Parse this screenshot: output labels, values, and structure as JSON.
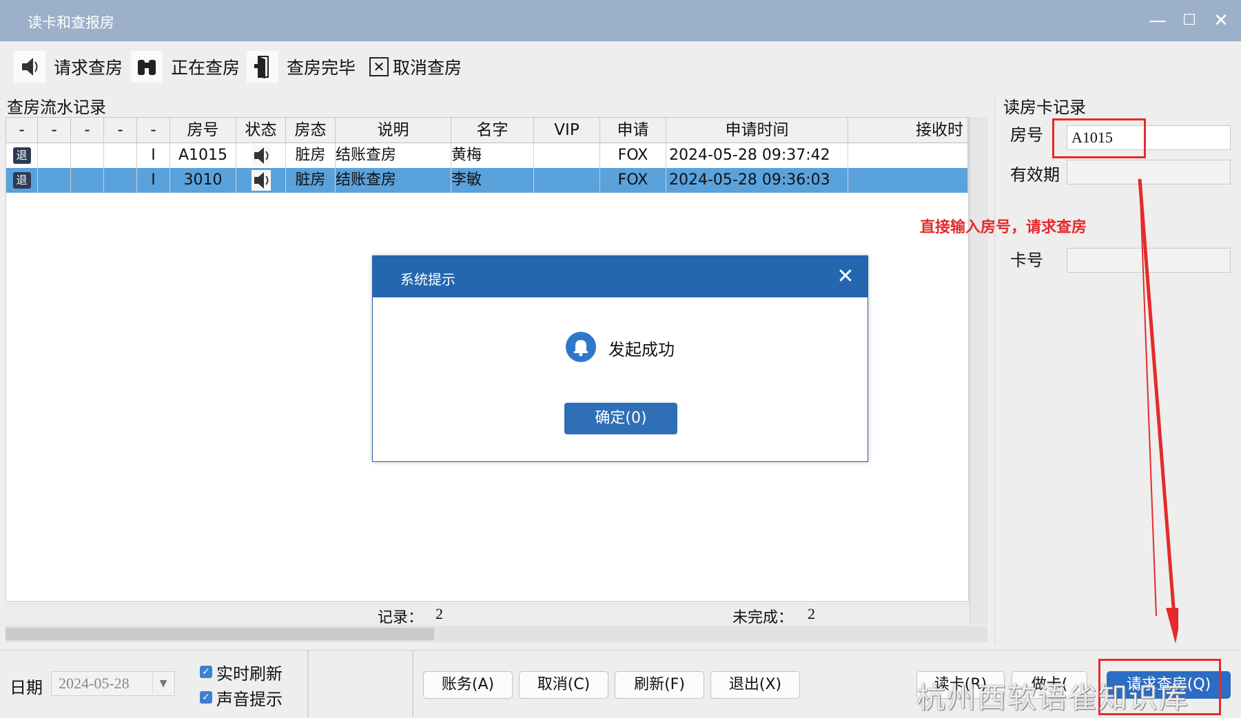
{
  "window": {
    "title": "读卡和查报房",
    "minimize": "—",
    "maximize": "☐",
    "close": "✕"
  },
  "toolbar": [
    {
      "label": "请求查房",
      "icon": "speaker-icon"
    },
    {
      "label": "正在查房",
      "icon": "binoculars-icon"
    },
    {
      "label": "查房完毕",
      "icon": "door-icon"
    },
    {
      "label": "取消查房",
      "icon": "cancel-box-icon"
    }
  ],
  "left": {
    "title": "查房流水记录",
    "columns": [
      "-",
      "-",
      "-",
      "-",
      "-",
      "房号",
      "状态",
      "房态",
      "说明",
      "名字",
      "VIP",
      "申请",
      "申请时间",
      "接收时"
    ],
    "rows": [
      {
        "tag": "退",
        "c5": "I",
        "room": "A1015",
        "room_state": "脏房",
        "desc": "结账查房",
        "name": "黄梅",
        "vip": "",
        "applicant": "FOX",
        "time": "2024-05-28 09:37:42",
        "recv": "",
        "selected": false
      },
      {
        "tag": "退",
        "c5": "I",
        "room": "3010",
        "room_state": "脏房",
        "desc": "结账查房",
        "name": "李敏",
        "vip": "",
        "applicant": "FOX",
        "time": "2024-05-28 09:36:03",
        "recv": "",
        "selected": true
      }
    ],
    "footer": {
      "records_label": "记录：",
      "records": "2",
      "incomplete_label": "未完成：",
      "incomplete": "2"
    }
  },
  "right": {
    "title": "读房卡记录",
    "room_label": "房号",
    "room_value": "A1015",
    "valid_label": "有效期",
    "valid_value": "",
    "card_label": "卡号",
    "card_value": "",
    "annotation": "直接输入房号，请求查房"
  },
  "bottom": {
    "date_label": "日期",
    "date_value": "2024-05-28",
    "realtime_refresh": "实时刷新",
    "sound_prompt": "声音提示",
    "buttons": [
      "账务(A)",
      "取消(C)",
      "刷新(F)",
      "退出(X)"
    ],
    "read_card": "读卡(R)",
    "make_card": "做卡(",
    "request_check": "请求查房(Q)",
    "watermark": "杭州西软语雀知识库"
  },
  "modal": {
    "title": "系统提示",
    "message": "发起成功",
    "ok": "确定(0)"
  },
  "colors": {
    "titlebar": "#9db0c9",
    "selected_row": "#5aa2dc",
    "modal_header": "#2466b0",
    "annotation": "#e52a2a"
  }
}
